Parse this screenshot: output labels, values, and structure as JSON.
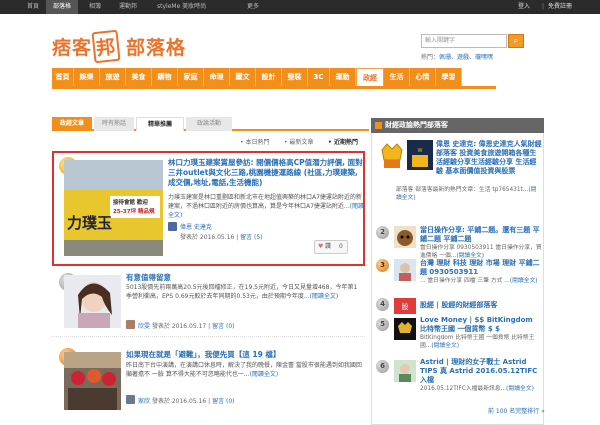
{
  "topbar": {
    "links": [
      "首頁",
      "部落格",
      "相簿",
      "運動邦",
      "styleMe 美妝時尚",
      "更多"
    ],
    "login": "登入",
    "signup": "免費註冊"
  },
  "logo": {
    "main_a": "痞客",
    "bang": "邦",
    "sub": "部落格"
  },
  "search": {
    "placeholder": "輸入關鍵字",
    "hot_label": "熱門：",
    "hot_keywords": "佩珊、遊戲、瓏嘿嘿"
  },
  "nav": [
    "首頁",
    "娛樂",
    "旅遊",
    "美食",
    "購物",
    "家庭",
    "命理",
    "圖文",
    "設計",
    "整裝",
    "3C",
    "運動",
    "政經",
    "生活",
    "心情",
    "學習"
  ],
  "nav_active_index": 12,
  "left_tabs": {
    "tab1": "政經文章",
    "tab2": "時有熱話",
    "tab3": "精華推薦",
    "tab4": "政論活動"
  },
  "sort": {
    "by_day": "本日熱門",
    "latest": "最新文章",
    "by_week": "近期熱門"
  },
  "articles": [
    {
      "rank": "1",
      "title": "林口力璞玉建案賞屋參訪: 開價價格高CP值潛力評價, 面對三井outlet與文化三路,桃園機捷運路線 (社區,力璞建築,成交價,地址,電話,生活機能)",
      "excerpt": "力璞玉建案是林口重劃區和新北市在地超值興築的林口A7捷運站附近的新建案，不過林口區附近的房價也算高，算是今年林口A7捷運站附近...",
      "more": "(閱讀全文)",
      "author": "偉恩 史達克",
      "date": "發表於 2016.05.16",
      "comment": "留言 (5)",
      "thumb_text": "力璞玉",
      "thumb_sub1": "接待會館 歡迎",
      "thumb_sub2": "25-37坪 精品規"
    },
    {
      "rank": "2",
      "title": "有意值得留意",
      "excerpt": "5013股價先前兩萬高20.5元後回檔修正，在19.5元附近，今日又見量增468，今年第1季營利衝高，EPS 0.69元較於去年同期的0.53元，由於預期今年度...",
      "more": "(閱讀全文)",
      "author": "欣雯",
      "date": "發表於 2016.05.17",
      "comment": "留言 (0)"
    },
    {
      "rank": "3",
      "title": "如果現在就是「避難」，我便先買【這 19 檔】",
      "excerpt": "昨日南下台中演講，在演講口休息時，解決了我的晚餐，陳金蕾 當股市很能遇到如我國回 顯著擔不 一臉 算不得大能不可忽略能代也一...",
      "more": "(閱讀全文)",
      "author": "家欣",
      "date": "發表於 2016.05.16",
      "comment": "留言 (0)"
    }
  ],
  "like": {
    "label": "讚",
    "count": "0"
  },
  "rank_panel": {
    "title": "財經政論熱門部落客",
    "items": [
      {
        "title": "偉恩 史達克: 偉恩史達克人氣財經部落客 投資美食旅遊開箱各種生活經驗分享生活經驗分享 生活經驗 基本面價值投資與股票",
        "excerpt": "部落客 部落客最新的熱門文章：生活 tp765431t...",
        "more": "(閱讀全文)"
      },
      {
        "title": "當日操作分享: 平鋪二題。還有三題 平鋪二題 平鋪二題",
        "excerpt": "當日操作分享 0930503911 當日操作分享，買進價格 一個...",
        "more": "(閱讀全文)"
      },
      {
        "title": "台灣 理財 科技 理財 市場 理財 平鋪二題 0930503911",
        "excerpt": "... 當日操作分享 四檔 三筆 方式 ...",
        "more": "(閱讀全文)"
      },
      {
        "title": "股經 | 股經的財經部落客",
        "excerpt": "",
        "more": "(閱讀全文)"
      },
      {
        "title": "Love Money | $$ BitKingdom 比特幣王國 一個貨幣 $ $",
        "excerpt": "BitKingdom 比特幣王國 一個貨幣 比特幣王國...",
        "more": "(閱讀全文)"
      },
      {
        "title": "Astrid | 理財的女子戰士 Astrid TIPS 真 Astrid 2016.05.12TIFC 入檔",
        "excerpt": "2016.05.12TIFC入檔最新訊息...",
        "more": "(閱讀全文)"
      }
    ],
    "more_link": "前 100 名完整排行 »"
  },
  "colors": {
    "accent": "#f28f1b",
    "link": "#2a6fb5",
    "highlight": "#e03030"
  }
}
